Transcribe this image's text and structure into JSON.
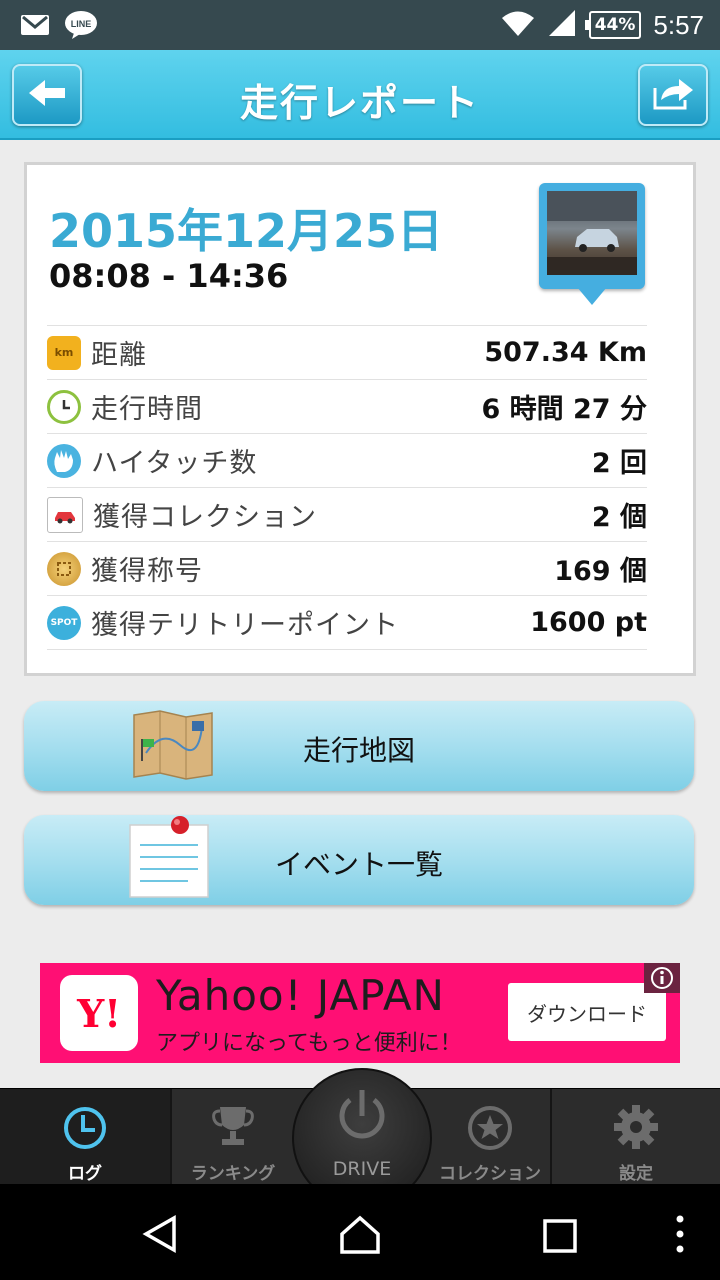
{
  "status_bar": {
    "time": "5:57",
    "battery": "44%",
    "icons": [
      "gmail-icon",
      "line-icon",
      "wifi-icon",
      "signal-icon",
      "battery-icon"
    ],
    "line_label": "LINE"
  },
  "app_bar": {
    "title": "走行レポート",
    "back_icon": "back-arrow-icon",
    "share_icon": "share-icon"
  },
  "report": {
    "date": "2015年12月25日",
    "time_range": "08:08 - 14:36",
    "rows": [
      {
        "icon": "km-icon",
        "icon_text": "km",
        "color": "#f2b11e",
        "label": "距離",
        "value": "507.34 Km"
      },
      {
        "icon": "clock-icon",
        "color": "#8dc13f",
        "label": "走行時間",
        "value": "6 時間 27 分"
      },
      {
        "icon": "hand-icon",
        "color": "#4ab3e0",
        "label": "ハイタッチ数",
        "value": "2 回"
      },
      {
        "icon": "car-card-icon",
        "color": "#e3363d",
        "label": "獲得コレクション",
        "value": "2 個"
      },
      {
        "icon": "medal-icon",
        "color": "#c9922c",
        "label": "獲得称号",
        "value": "169 個"
      },
      {
        "icon": "spot-icon",
        "icon_text": "SPOT",
        "color": "#3cb0dc",
        "label": "獲得テリトリーポイント",
        "value": "1600 pt"
      }
    ]
  },
  "buttons": {
    "map_label": "走行地図",
    "events_label": "イベント一覧"
  },
  "ad": {
    "logo": "Y!",
    "title": "Yahoo! JAPAN",
    "subtitle": "アプリになってもっと便利に！",
    "button": "ダウンロード"
  },
  "tabs": [
    {
      "label": "ログ",
      "icon": "clock-icon",
      "active": true
    },
    {
      "label": "ランキング",
      "icon": "trophy-icon",
      "active": false
    },
    {
      "label": "DRIVE",
      "icon": "power-icon",
      "active": false
    },
    {
      "label": "コレクション",
      "icon": "star-icon",
      "active": false
    },
    {
      "label": "設定",
      "icon": "gear-icon",
      "active": false
    }
  ],
  "colors": {
    "accent": "#33bde0",
    "date_text": "#3aaad3",
    "ad_bg": "#ff0f74",
    "active_tab": "#4fc3ee"
  }
}
